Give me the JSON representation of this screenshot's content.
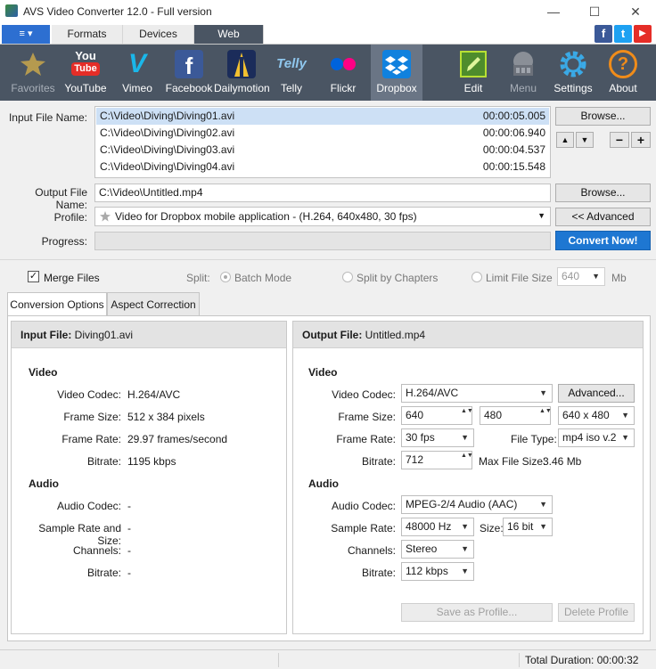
{
  "window": {
    "title": "AVS Video Converter 12.0 - Full version",
    "minimize": "—",
    "maximize": "☐",
    "close": "✕"
  },
  "menu_button": "≡ ▾",
  "top_tabs": [
    "Formats",
    "Devices",
    "Web"
  ],
  "social": {
    "facebook": "f",
    "twitter": "t",
    "youtube": "▶"
  },
  "toolbar": {
    "favorites": "Favorites",
    "youtube": "YouTube",
    "vimeo": "Vimeo",
    "facebook": "Facebook",
    "dailymotion": "Dailymotion",
    "telly": "Telly",
    "flickr": "Flickr",
    "dropbox": "Dropbox",
    "edit": "Edit",
    "menu": "Menu",
    "settings": "Settings",
    "about": "About",
    "youtube_logo": "You",
    "youtube_logo2": "Tube",
    "telly_logo": "Telly",
    "vimeo_logo": "V",
    "facebook_logo": "f",
    "about_logo": "?"
  },
  "input": {
    "label": "Input File Name:",
    "files": [
      {
        "path": "C:\\Video\\Diving\\Diving01.avi",
        "duration": "00:00:05.005"
      },
      {
        "path": "C:\\Video\\Diving\\Diving02.avi",
        "duration": "00:00:06.940"
      },
      {
        "path": "C:\\Video\\Diving\\Diving03.avi",
        "duration": "00:00:04.537"
      },
      {
        "path": "C:\\Video\\Diving\\Diving04.avi",
        "duration": "00:00:15.548"
      }
    ],
    "browse": "Browse...",
    "up": "▲",
    "down": "▼",
    "minus": "−",
    "plus": "+"
  },
  "output": {
    "label": "Output File Name:",
    "value": "C:\\Video\\Untitled.mp4",
    "browse": "Browse..."
  },
  "profile": {
    "label": "Profile:",
    "value": "Video for Dropbox mobile application - (H.264, 640x480, 30 fps)",
    "advanced": "<< Advanced"
  },
  "progress": {
    "label": "Progress:",
    "convert": "Convert Now!"
  },
  "merge": {
    "label": "Merge Files",
    "checked": "✓"
  },
  "split": {
    "label": "Split:",
    "batch": "Batch Mode",
    "chapters": "Split by Chapters",
    "limit": "Limit File Size",
    "size": "640",
    "unit": "Mb"
  },
  "tabs": {
    "conversion": "Conversion Options",
    "aspect": "Aspect Correction"
  },
  "input_panel": {
    "head_label": "Input File:",
    "head_value": "Diving01.avi",
    "video": "Video",
    "video_codec_k": "Video Codec:",
    "video_codec_v": "H.264/AVC",
    "frame_size_k": "Frame Size:",
    "frame_size_v": "512 x 384 pixels",
    "frame_rate_k": "Frame Rate:",
    "frame_rate_v": "29.97 frames/second",
    "bitrate_k": "Bitrate:",
    "bitrate_v": "1195 kbps",
    "audio": "Audio",
    "audio_codec_k": "Audio Codec:",
    "audio_codec_v": "-",
    "sample_k": "Sample Rate and Size:",
    "sample_v": "-",
    "channels_k": "Channels:",
    "channels_v": "-",
    "abitrate_k": "Bitrate:",
    "abitrate_v": "-"
  },
  "output_panel": {
    "head_label": "Output File:",
    "head_value": "Untitled.mp4",
    "video": "Video",
    "video_codec_k": "Video Codec:",
    "video_codec_v": "H.264/AVC",
    "advanced": "Advanced...",
    "frame_size_k": "Frame Size:",
    "width": "640",
    "height": "480",
    "preset": "640 x 480",
    "frame_rate_k": "Frame Rate:",
    "frame_rate_v": "30 fps",
    "file_type_k": "File Type:",
    "file_type_v": "mp4 iso v.2",
    "bitrate_k": "Bitrate:",
    "bitrate_v": "712",
    "max_size_k": "Max File Size:",
    "max_size_v": "3.46 Mb",
    "audio": "Audio",
    "audio_codec_k": "Audio Codec:",
    "audio_codec_v": "MPEG-2/4 Audio (AAC)",
    "sample_k": "Sample Rate:",
    "sample_v": "48000 Hz",
    "size_k": "Size:",
    "size_v": "16 bit",
    "channels_k": "Channels:",
    "channels_v": "Stereo",
    "abitrate_k": "Bitrate:",
    "abitrate_v": "112 kbps",
    "save_profile": "Save as Profile...",
    "delete_profile": "Delete Profile"
  },
  "status": {
    "total": "Total Duration: 00:00:32"
  },
  "glyphs": {
    "dd": "▼",
    "spin": "▲▼"
  }
}
